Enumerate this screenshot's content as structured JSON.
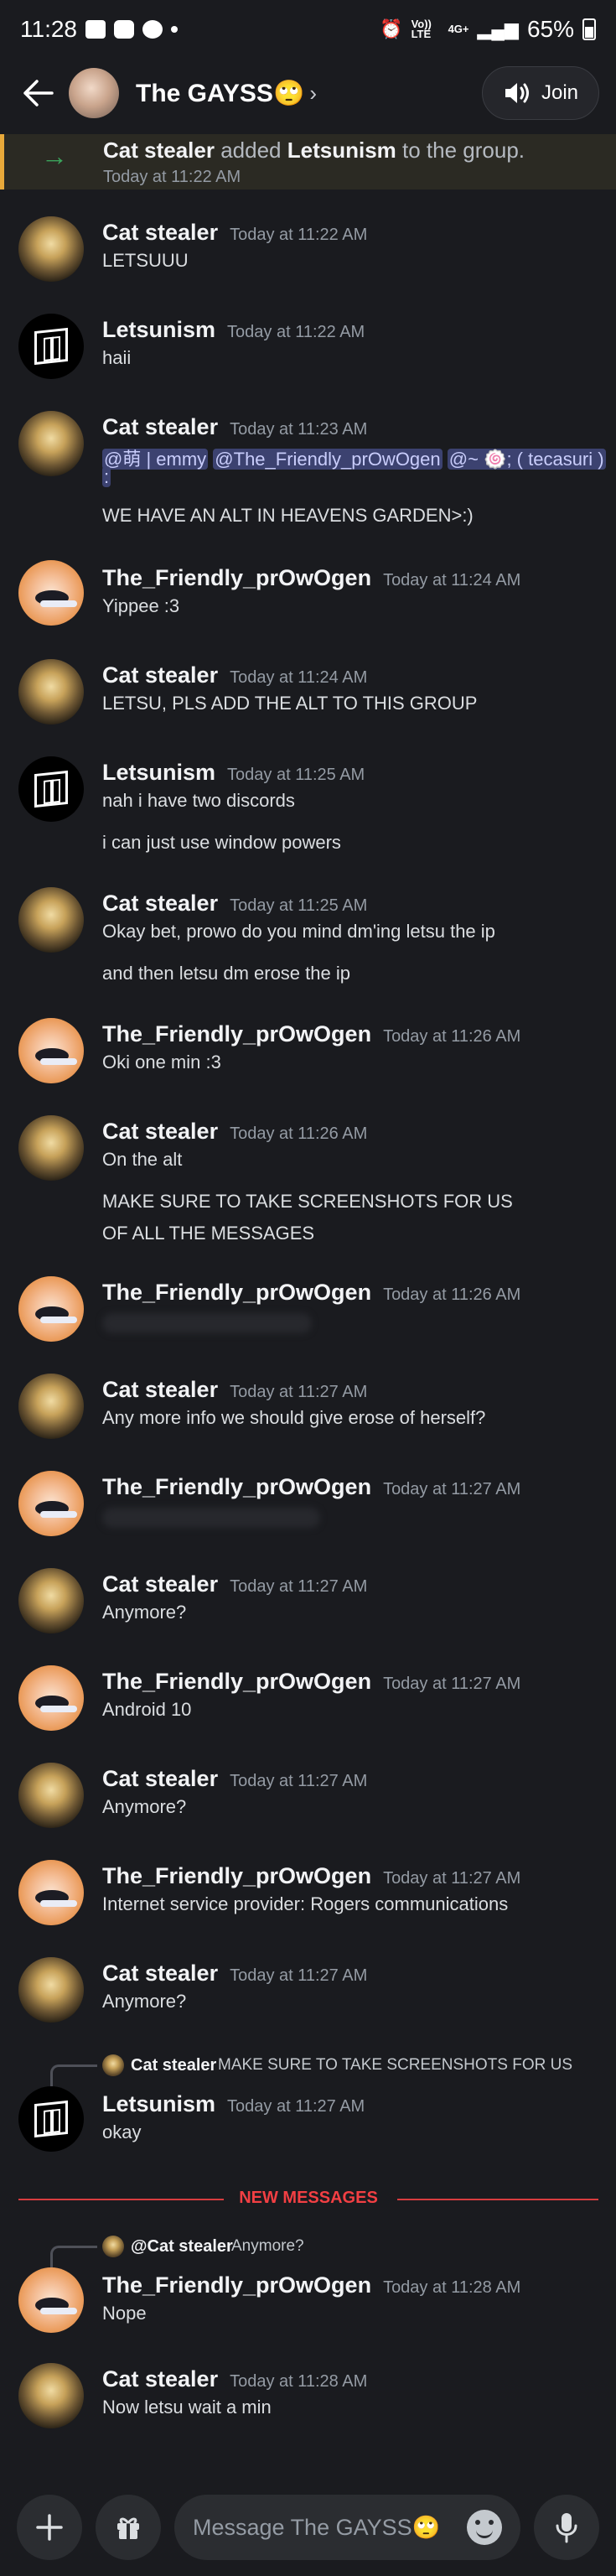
{
  "status_bar": {
    "time": "11:28",
    "network": "Vo)) LTE",
    "signal": "4G+",
    "battery": "65%"
  },
  "header": {
    "title": "The GAYSS🙄",
    "join_label": "Join"
  },
  "system_message": {
    "actor": "Cat stealer",
    "action": "added",
    "target": "Letsunism",
    "suffix": "to the group.",
    "time": "Today at 11:22 AM"
  },
  "messages": [
    {
      "author": "Cat stealer",
      "time": "Today at 11:22 AM",
      "lines": [
        "LETSUUU"
      ]
    },
    {
      "author": "Letsunism",
      "time": "Today at 11:22 AM",
      "lines": [
        "haii"
      ]
    },
    {
      "author": "Cat stealer",
      "time": "Today at 11:23 AM",
      "mentions": [
        "@萌 | emmy",
        "@The_Friendly_prOwOgen",
        "@~ 🍥; ( tecasuri )",
        ":"
      ],
      "lines": [
        "WE HAVE AN ALT IN HEAVENS GARDEN>:)"
      ]
    },
    {
      "author": "The_Friendly_prOwOgen",
      "time": "Today at 11:24 AM",
      "lines": [
        "Yippee :3"
      ]
    },
    {
      "author": "Cat stealer",
      "time": "Today at 11:24 AM",
      "lines": [
        "LETSU, PLS ADD THE ALT TO THIS GROUP"
      ]
    },
    {
      "author": "Letsunism",
      "time": "Today at 11:25 AM",
      "lines": [
        "nah i have two discords",
        "i can just use window powers"
      ]
    },
    {
      "author": "Cat stealer",
      "time": "Today at 11:25 AM",
      "lines": [
        "Okay bet, prowo do you mind dm'ing letsu the ip",
        "and then letsu dm erose the ip"
      ]
    },
    {
      "author": "The_Friendly_prOwOgen",
      "time": "Today at 11:26 AM",
      "lines": [
        "Oki one min :3"
      ]
    },
    {
      "author": "Cat stealer",
      "time": "Today at 11:26 AM",
      "lines": [
        "On the alt",
        "MAKE SURE TO TAKE SCREENSHOTS FOR US",
        "OF ALL THE MESSAGES"
      ]
    },
    {
      "author": "The_Friendly_prOwOgen",
      "time": "Today at 11:26 AM",
      "lines": []
    },
    {
      "author": "Cat stealer",
      "time": "Today at 11:27 AM",
      "lines": [
        "Any more info we should give erose of herself?"
      ]
    },
    {
      "author": "The_Friendly_prOwOgen",
      "time": "Today at 11:27 AM",
      "lines": []
    },
    {
      "author": "Cat stealer",
      "time": "Today at 11:27 AM",
      "lines": [
        "Anymore?"
      ]
    },
    {
      "author": "The_Friendly_prOwOgen",
      "time": "Today at 11:27 AM",
      "lines": [
        "Android 10"
      ]
    },
    {
      "author": "Cat stealer",
      "time": "Today at 11:27 AM",
      "lines": [
        "Anymore?"
      ]
    },
    {
      "author": "The_Friendly_prOwOgen",
      "time": "Today at 11:27 AM",
      "lines": [
        "Internet service provider: Rogers communications"
      ]
    },
    {
      "author": "Cat stealer",
      "time": "Today at 11:27 AM",
      "lines": [
        "Anymore?"
      ]
    },
    {
      "reply_author": "Cat stealer",
      "reply_text": "MAKE SURE TO TAKE SCREENSHOTS FOR US",
      "author": "Letsunism",
      "time": "Today at 11:27 AM",
      "lines": [
        "okay"
      ]
    },
    {
      "reply_author": "@Cat stealer",
      "reply_text": "Anymore?",
      "author": "The_Friendly_prOwOgen",
      "time": "Today at 11:28 AM",
      "lines": [
        "Nope"
      ]
    },
    {
      "author": "Cat stealer",
      "time": "Today at 11:28 AM",
      "lines": [
        "Now letsu wait a min"
      ]
    }
  ],
  "divider": {
    "label": "NEW MESSAGES"
  },
  "composer": {
    "placeholder": "Message The GAYSS🙄"
  },
  "colors": {
    "background": "#1a1b1f",
    "mention_bg": "#3c4270",
    "new_messages_red": "#f23f43",
    "system_bar": "#e8a93a"
  },
  "icons": [
    "back-arrow-icon",
    "chevron-right-icon",
    "speaker-icon",
    "join-arrow-icon",
    "plus-icon",
    "gift-icon",
    "emoji-icon",
    "microphone-icon"
  ]
}
